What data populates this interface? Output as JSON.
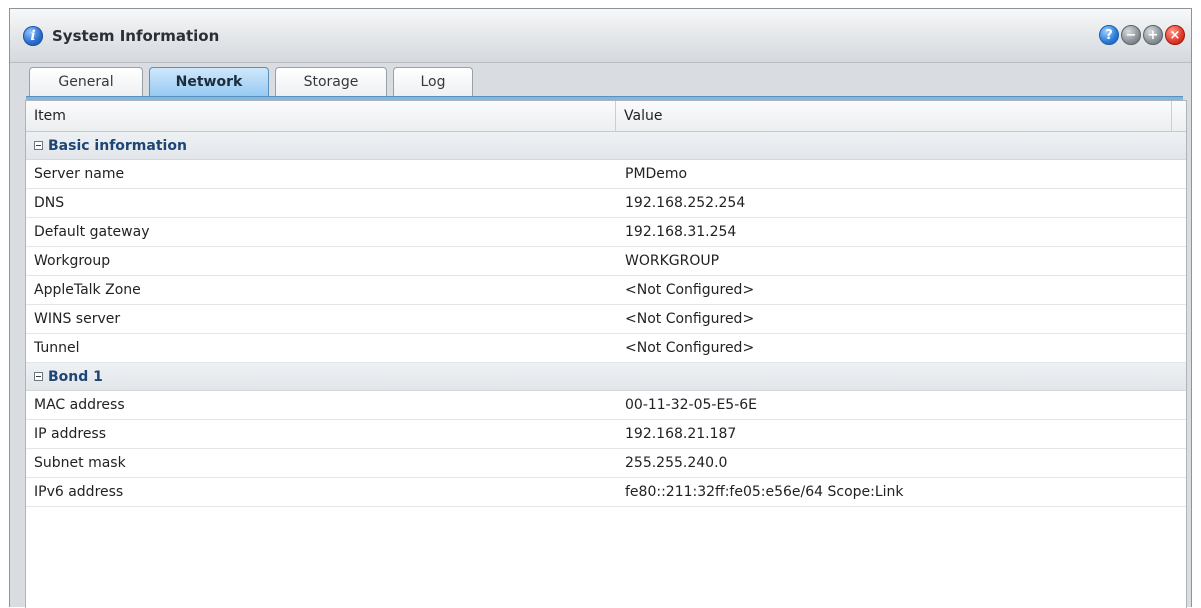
{
  "window": {
    "title": "System Information",
    "controls": [
      "help-icon",
      "minimize-icon",
      "maximize-icon",
      "close-icon"
    ]
  },
  "tabs": [
    {
      "label": "General",
      "active": false
    },
    {
      "label": "Network",
      "active": true
    },
    {
      "label": "Storage",
      "active": false
    },
    {
      "label": "Log",
      "active": false
    }
  ],
  "grid": {
    "columns": {
      "item": "Item",
      "value": "Value"
    },
    "groups": [
      {
        "label": "Basic information",
        "rows": [
          {
            "item": "Server name",
            "value": "PMDemo"
          },
          {
            "item": "DNS",
            "value": "192.168.252.254"
          },
          {
            "item": "Default gateway",
            "value": "192.168.31.254"
          },
          {
            "item": "Workgroup",
            "value": "WORKGROUP"
          },
          {
            "item": "AppleTalk Zone",
            "value": "<Not Configured>"
          },
          {
            "item": "WINS server",
            "value": "<Not Configured>"
          },
          {
            "item": "Tunnel",
            "value": "<Not Configured>"
          }
        ]
      },
      {
        "label": "Bond 1",
        "rows": [
          {
            "item": "MAC address",
            "value": "00-11-32-05-E5-6E"
          },
          {
            "item": "IP address",
            "value": "192.168.21.187"
          },
          {
            "item": "Subnet mask",
            "value": "255.255.240.0"
          },
          {
            "item": "IPv6 address",
            "value": "fe80::211:32ff:fe05:e56e/64 Scope:Link"
          }
        ]
      }
    ]
  },
  "colors": {
    "active_tab": "#93c8f2",
    "group_text": "#1d4674",
    "close_button": "#e0392a",
    "help_button": "#2a7ad8"
  }
}
